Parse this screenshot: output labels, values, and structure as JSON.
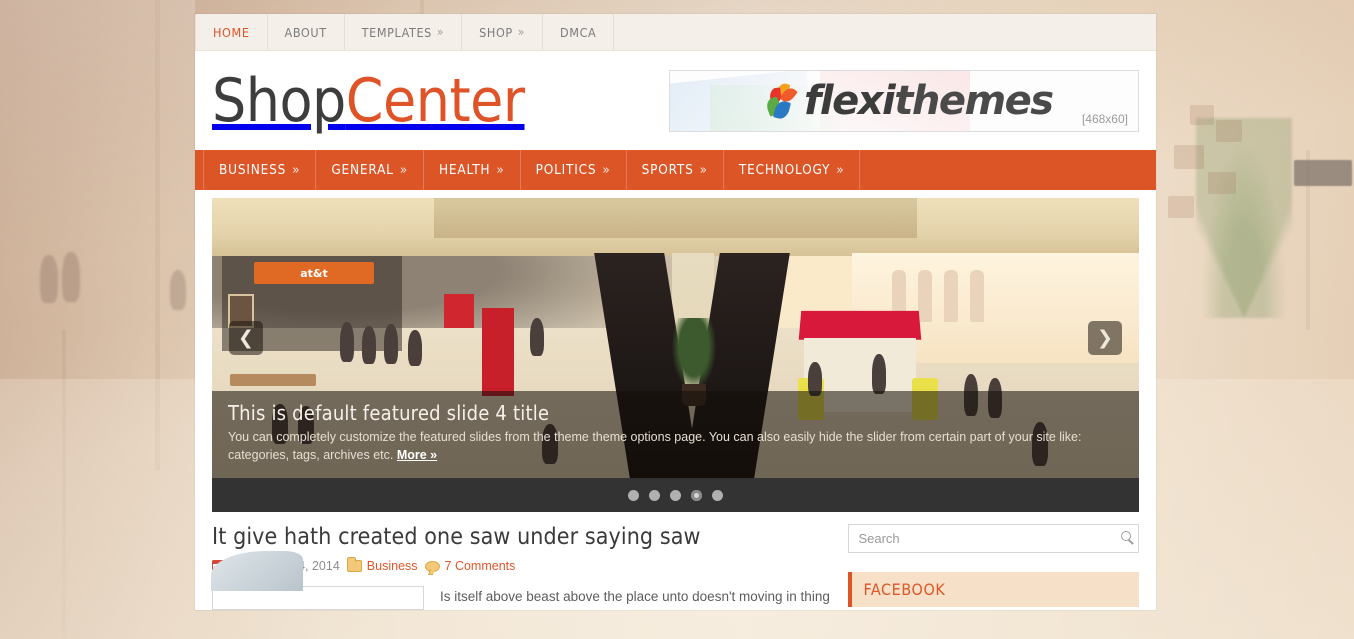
{
  "topnav": {
    "items": [
      {
        "label": "HOME",
        "active": true,
        "caret": ""
      },
      {
        "label": "ABOUT",
        "active": false,
        "caret": ""
      },
      {
        "label": "TEMPLATES",
        "active": false,
        "caret": "»"
      },
      {
        "label": "SHOP",
        "active": false,
        "caret": "»"
      },
      {
        "label": "DMCA",
        "active": false,
        "caret": ""
      }
    ]
  },
  "logo": {
    "part1": "Shop",
    "part2": "Center"
  },
  "banner": {
    "brand_light": "flexi",
    "brand_dark": "themes",
    "size_label": "[468x60]"
  },
  "catnav": {
    "items": [
      {
        "label": "BUSINESS",
        "caret": "»"
      },
      {
        "label": "GENERAL",
        "caret": "»"
      },
      {
        "label": "HEALTH",
        "caret": "»"
      },
      {
        "label": "POLITICS",
        "caret": "»"
      },
      {
        "label": "SPORTS",
        "caret": "»"
      },
      {
        "label": "TECHNOLOGY",
        "caret": "»"
      }
    ]
  },
  "slider": {
    "prev_icon": "❮",
    "next_icon": "❯",
    "caption_title": "This is default featured slide 4 title",
    "caption_text": "You can completely customize the featured slides from the theme theme options page. You can also easily hide the slider from certain part of your site like: categories, tags, archives etc. ",
    "caption_more": "More »",
    "dots_total": 5,
    "dot_active_index": 4,
    "slide_alt": "shopping mall interior with escalators"
  },
  "post": {
    "title": "It give hath created one saw under saying saw",
    "date": "December 24, 2014",
    "category": "Business",
    "comments": "7 Comments",
    "excerpt": "Is itself above beast above the place unto doesn't moving in thing"
  },
  "sidebar": {
    "search_placeholder": "Search",
    "search_value": "",
    "widgets": [
      {
        "title": "FACEBOOK"
      }
    ]
  },
  "colors": {
    "accent": "#db5526",
    "accent_dark": "#de5327",
    "topbar_bg": "#f4efe9",
    "widget_bg": "#f6e0c7",
    "page_bg": "#d8c3ad"
  }
}
